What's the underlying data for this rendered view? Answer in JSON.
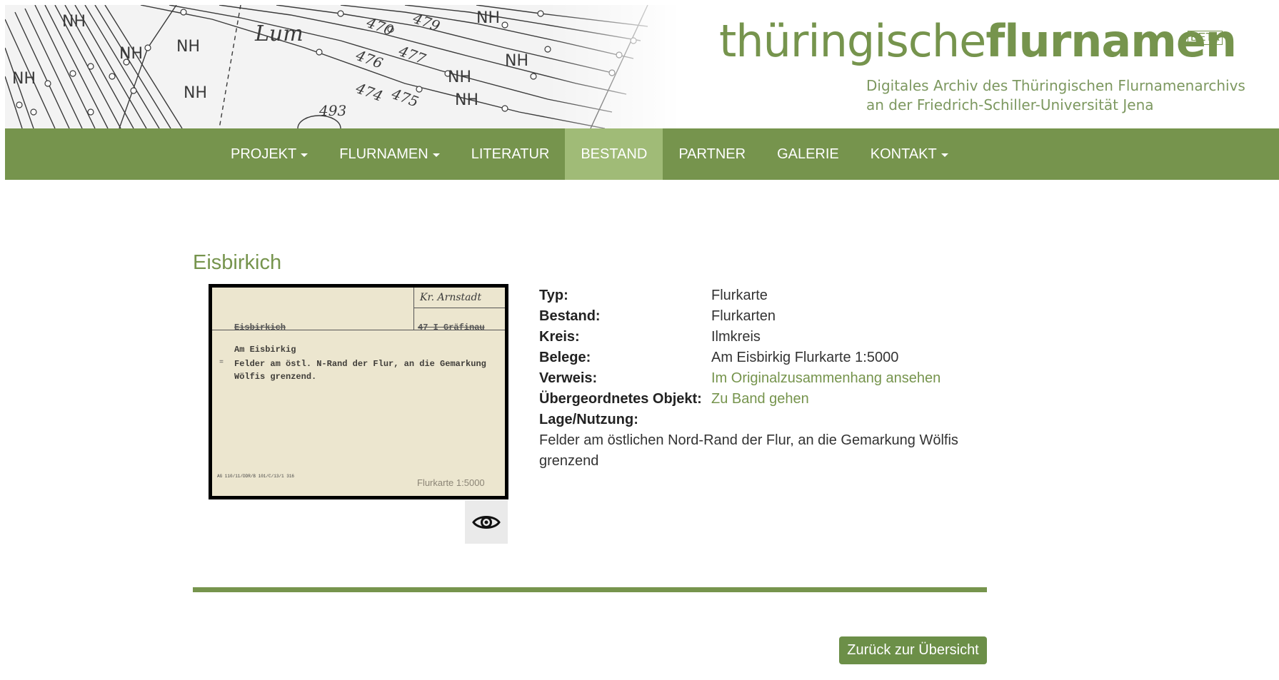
{
  "header": {
    "logo": {
      "light": "thüringische",
      "bold": "flurnamen",
      "beta": "BETA"
    },
    "subtitle": [
      "Digitales Archiv des Thüringischen Flurnamenarchivs",
      "an der Friedrich-Schiller-Universität Jena"
    ],
    "map_labels": [
      "NH",
      "NH",
      "NH",
      "NH",
      "NH",
      "NH",
      "NH",
      "NH",
      "470",
      "479",
      "476",
      "477",
      "474",
      "475",
      "493"
    ]
  },
  "nav": {
    "items": [
      {
        "label": "PROJEKT",
        "dropdown": true,
        "active": false
      },
      {
        "label": "FLURNAMEN",
        "dropdown": true,
        "active": false
      },
      {
        "label": "LITERATUR",
        "dropdown": false,
        "active": false
      },
      {
        "label": "BESTAND",
        "dropdown": false,
        "active": true
      },
      {
        "label": "PARTNER",
        "dropdown": false,
        "active": false
      },
      {
        "label": "GALERIE",
        "dropdown": false,
        "active": false
      },
      {
        "label": "KONTAKT",
        "dropdown": true,
        "active": false
      }
    ]
  },
  "main": {
    "title": "Eisbirkich",
    "card": {
      "kreis": "Kr. Arnstadt",
      "name": "Eisbirkich",
      "ort": "47 I Gräfinau",
      "lines": [
        "Am Eisbirkig",
        "Felder am östl. N-Rand der Flur, an die Gemarkung",
        "Wölfis grenzend."
      ],
      "footer_code": "AG 110/11/DDR/B 101/C/13/1 316",
      "label": "Flurkarte 1:5000"
    },
    "view_icon": "eye-icon",
    "fields": [
      {
        "label": "Typ:",
        "value": "Flurkarte",
        "link": false
      },
      {
        "label": "Bestand:",
        "value": "Flurkarten",
        "link": false
      },
      {
        "label": "Kreis:",
        "value": "Ilmkreis",
        "link": false
      },
      {
        "label": "Belege:",
        "value": "Am Eisbirkig Flurkarte 1:5000",
        "link": false
      },
      {
        "label": "Verweis:",
        "value": "Im Originalzusammenhang ansehen",
        "link": true
      },
      {
        "label": "Übergeordnetes Objekt:",
        "value": "Zu Band gehen",
        "link": true
      }
    ],
    "lage": {
      "label": "Lage/Nutzung:",
      "text": "Felder am östlichen Nord-Rand der Flur, an die Gemarkung Wölfis grenzend"
    },
    "back_button": "Zurück zur Übersicht"
  },
  "colors": {
    "accent": "#76944d",
    "nav_active": "#a0bb77",
    "button": "#6c8f48"
  }
}
